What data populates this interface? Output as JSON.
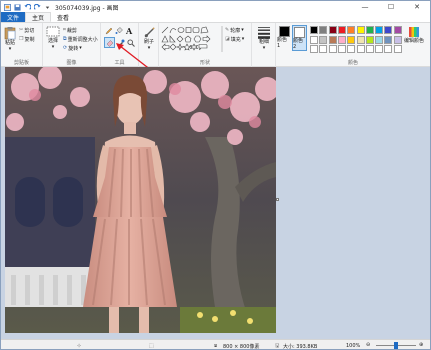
{
  "window": {
    "title": "305074039.jpg - 画图",
    "minimize": "—",
    "maximize": "☐",
    "close": "✕"
  },
  "tabs": {
    "file": "文件",
    "home": "主页",
    "view": "查看"
  },
  "clipboard": {
    "paste": "粘贴",
    "cut": "剪切",
    "copy": "复制",
    "label": "剪贴板"
  },
  "image": {
    "select": "选择",
    "crop": "裁剪",
    "resize": "重新调整大小",
    "rotate": "旋转",
    "label": "图像"
  },
  "tools": {
    "label": "工具",
    "text": "A"
  },
  "brush": {
    "label": "刷子"
  },
  "shapes": {
    "outline": "轮廓",
    "fill": "填充",
    "label": "形状"
  },
  "size": {
    "label": "粗细"
  },
  "colors": {
    "color1": "颜色 1",
    "color2": "颜色 2",
    "edit": "编辑颜色",
    "label": "颜色",
    "palette": [
      "#000000",
      "#7f7f7f",
      "#880015",
      "#ed1c24",
      "#ff7f27",
      "#fff200",
      "#22b14c",
      "#00a2e8",
      "#3f48cc",
      "#a349a4",
      "#ffffff",
      "#c3c3c3",
      "#b97a57",
      "#ffaec9",
      "#ffc90e",
      "#efe4b0",
      "#b5e61d",
      "#99d9ea",
      "#7092be",
      "#c8bfe7",
      "#ffffff",
      "#ffffff",
      "#ffffff",
      "#ffffff",
      "#ffffff",
      "#ffffff",
      "#ffffff",
      "#ffffff",
      "#ffffff",
      "#ffffff"
    ]
  },
  "status": {
    "dimensions": "800 × 800像素",
    "filesize": "大小: 393.8KB",
    "zoom": "100%"
  }
}
